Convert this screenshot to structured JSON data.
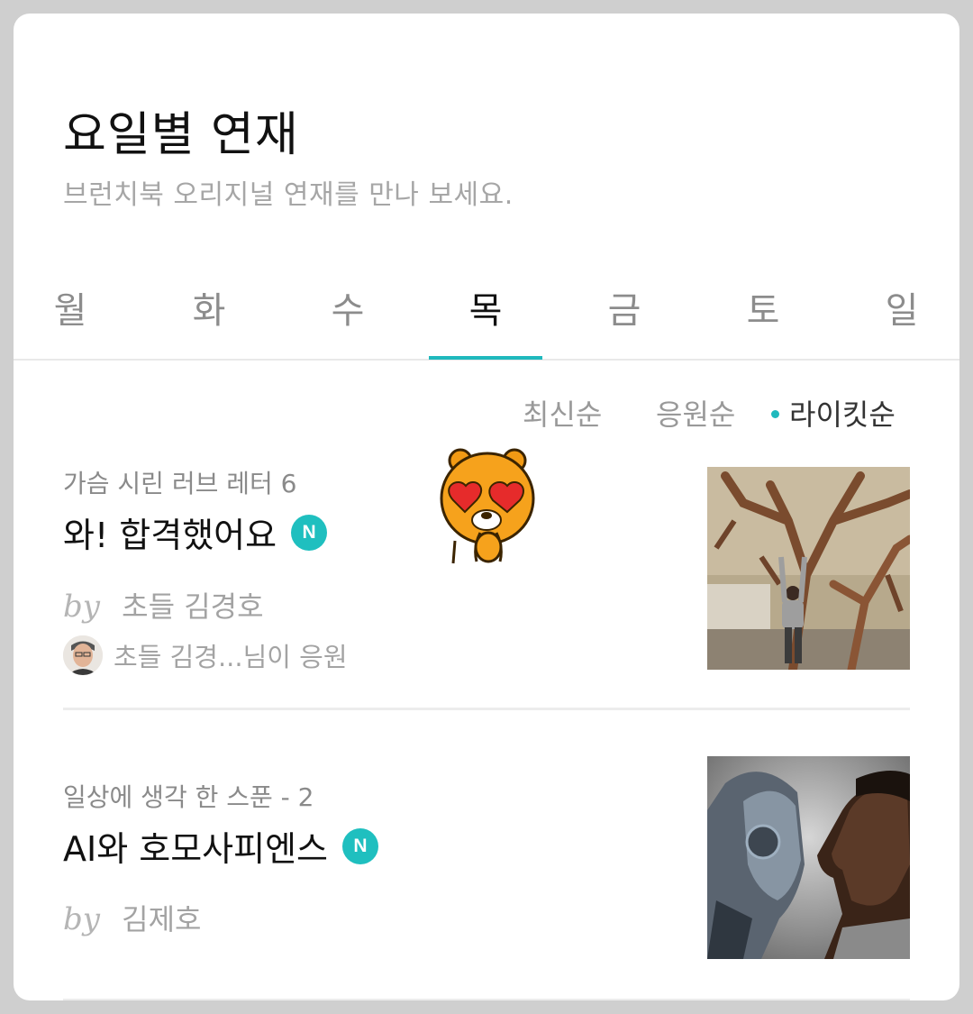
{
  "header": {
    "title": "요일별 연재",
    "subtitle": "브런치북 오리지널 연재를 만나 보세요."
  },
  "tabs": [
    "월",
    "화",
    "수",
    "목",
    "금",
    "토",
    "일"
  ],
  "active_tab": "목",
  "sort": {
    "options": [
      "최신순",
      "응원순",
      "라이킷순"
    ],
    "selected": "라이킷순"
  },
  "colors": {
    "accent": "#1fb9bd",
    "badge": "#1fbfbf"
  },
  "articles": [
    {
      "series": "가슴 시린 러브 레터 6",
      "title": "와! 합격했어요",
      "badge": "N",
      "by": "by",
      "author": "초들 김경호",
      "cheer_text": "초들 김경...님이 응원"
    },
    {
      "series": "일상에 생각 한 스푼 - 2",
      "title": "AI와 호모사피엔스",
      "badge": "N",
      "by": "by",
      "author": "김제호"
    }
  ]
}
